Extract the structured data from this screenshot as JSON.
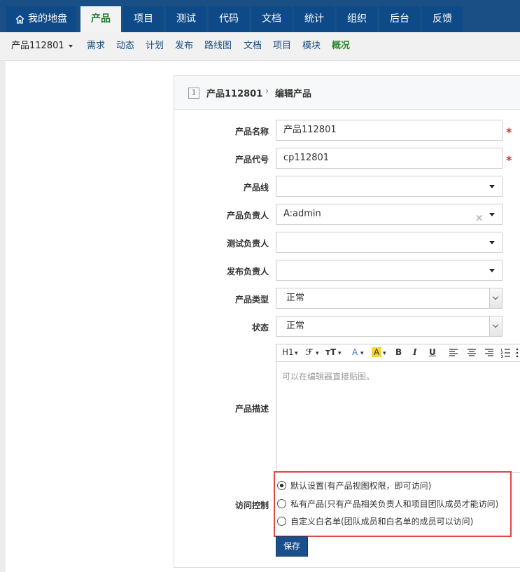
{
  "topnav": {
    "tabs": [
      {
        "label": "我的地盘",
        "active": false
      },
      {
        "label": "产品",
        "active": true
      },
      {
        "label": "项目",
        "active": false
      },
      {
        "label": "测试",
        "active": false
      },
      {
        "label": "代码",
        "active": false
      },
      {
        "label": "文档",
        "active": false
      },
      {
        "label": "统计",
        "active": false
      },
      {
        "label": "组织",
        "active": false
      },
      {
        "label": "后台",
        "active": false
      },
      {
        "label": "反馈",
        "active": false
      }
    ]
  },
  "subnav": {
    "product": "产品112801",
    "items": [
      "需求",
      "动态",
      "计划",
      "发布",
      "路线图",
      "文档",
      "项目",
      "模块",
      "概况"
    ]
  },
  "breadcrumb": {
    "id": "1",
    "product": "产品112801",
    "page": "编辑产品"
  },
  "form": {
    "name": {
      "label": "产品名称",
      "value": "产品112801"
    },
    "code": {
      "label": "产品代号",
      "value": "cp112801"
    },
    "line": {
      "label": "产品线",
      "value": ""
    },
    "owner": {
      "label": "产品负责人",
      "value": "A:admin"
    },
    "qa": {
      "label": "测试负责人",
      "value": ""
    },
    "release": {
      "label": "发布负责人",
      "value": ""
    },
    "type": {
      "label": "产品类型",
      "value": "正常"
    },
    "status": {
      "label": "状态",
      "value": "正常"
    },
    "desc": {
      "label": "产品描述",
      "placeholder": "可以在编辑器直接贴图。"
    },
    "acl": {
      "label": "访问控制",
      "options": [
        {
          "label": "默认设置(有产品视图权限，即可访问)",
          "checked": true
        },
        {
          "label": "私有产品(只有产品相关负责人和项目团队成员才能访问)",
          "checked": false
        },
        {
          "label": "自定义白名单(团队成员和白名单的成员可以访问)",
          "checked": false
        }
      ]
    },
    "save_label": "保存",
    "required_mark": "*"
  },
  "toolbar": {
    "heading": "H1",
    "font": "ℱ",
    "size": "тT",
    "color": "A",
    "bg": "A",
    "bold": "B",
    "italic": "I",
    "underline": "U"
  },
  "colors": {
    "nav_bg": "#1a4f85",
    "active_tab_text": "#1e7b29",
    "required": "#c83333",
    "highlight_border": "#e04646",
    "save_bg": "#19508c"
  }
}
